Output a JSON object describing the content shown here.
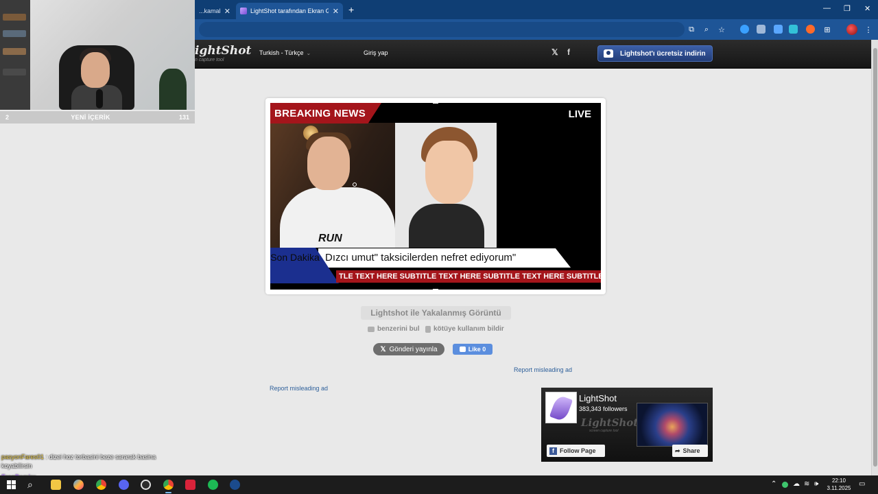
{
  "browser": {
    "tabs": [
      {
        "title": "...kamak b...",
        "active": false
      },
      {
        "title": "LightShot tarafından Ekran Görü...",
        "active": true
      }
    ],
    "new_tab": "+",
    "window_controls": [
      "—",
      "❐",
      "✕"
    ]
  },
  "webcam_bar": {
    "left": "2",
    "center": "YENİ İÇERİK",
    "right": "131"
  },
  "lightshot": {
    "logo": "ightShot",
    "logo_sub": "n capture tool",
    "language": "Turkish - Türkçe",
    "login": "Giriş yap",
    "twitter": "𝕏",
    "facebook": "f",
    "download_button": "Lightshot'ı ücretsiz indirin"
  },
  "screenshot": {
    "breaking": "BREAKING NEWS",
    "live": "LIVE",
    "headline": "Dızcı umut\" taksicilerden nefret ediyorum\"",
    "son_dakika": "Son Dakika",
    "ticker": "TLE TEXT HERE  SUBTITLE TEXT HERE  SUBTITLE TEXT HERE  SUBTITLE TEXT H",
    "shirt_text": "RUN"
  },
  "caption": "Lightshot ile Yakalanmış Görüntü",
  "actions": {
    "similar": "benzerini bul",
    "report_abuse": "kötüye kullanım bildir",
    "tweet": "Gönderi yayınla",
    "tweet_logo": "𝕏",
    "like": "Like 0"
  },
  "ads": {
    "report_right": "Report misleading ad",
    "report_left": "Report misleading ad"
  },
  "fb_widget": {
    "page_name": "LightShot",
    "followers": "383,343 followers",
    "wordmark": "LightShot",
    "tagline": "screen capture tool",
    "follow_label": "Follow Page",
    "share_label": "Share"
  },
  "chat": {
    "message_user": "pasyonFares01",
    "message_text": ": dizei hoz torbasini beze sararak basina koyabilirsin",
    "user2": "ErenDemirx"
  },
  "taskbar": {
    "time": "22:10",
    "date": "3.11.2025"
  },
  "colors": {
    "tab_bar": "#0f3e74",
    "toolbar": "#1e5597",
    "news_red": "#a4151b",
    "download_blue": "#2d4f94"
  }
}
